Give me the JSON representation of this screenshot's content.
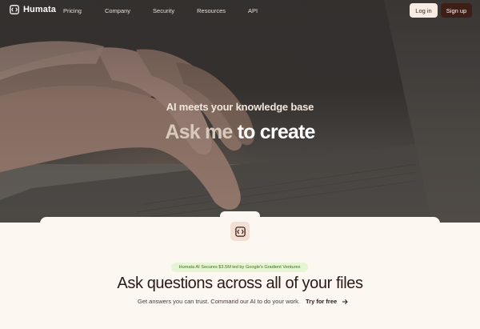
{
  "brand": {
    "name": "Humata",
    "logo_icon": "humata-logo-icon"
  },
  "nav": {
    "links": [
      "Pricing",
      "Company",
      "Security",
      "Resources",
      "API"
    ],
    "login_label": "Log in",
    "signup_label": "Sign up"
  },
  "hero": {
    "subtitle": "AI meets your knowledge base",
    "title_muted": "Ask me",
    "title_bright": "to create"
  },
  "section": {
    "badge": "Humata AI Secures $3.5M led by Google's Gradient Ventures",
    "headline": "Ask questions across all of your files",
    "subline": "Get answers you can trust. Command our AI to do your work.",
    "cta_label": "Try for free"
  },
  "colors": {
    "primary_dark": "#3d1f17",
    "login_bg": "#f7ebe3",
    "badge_bg": "#e6f5d3",
    "page_bg": "#fcf7f1"
  }
}
